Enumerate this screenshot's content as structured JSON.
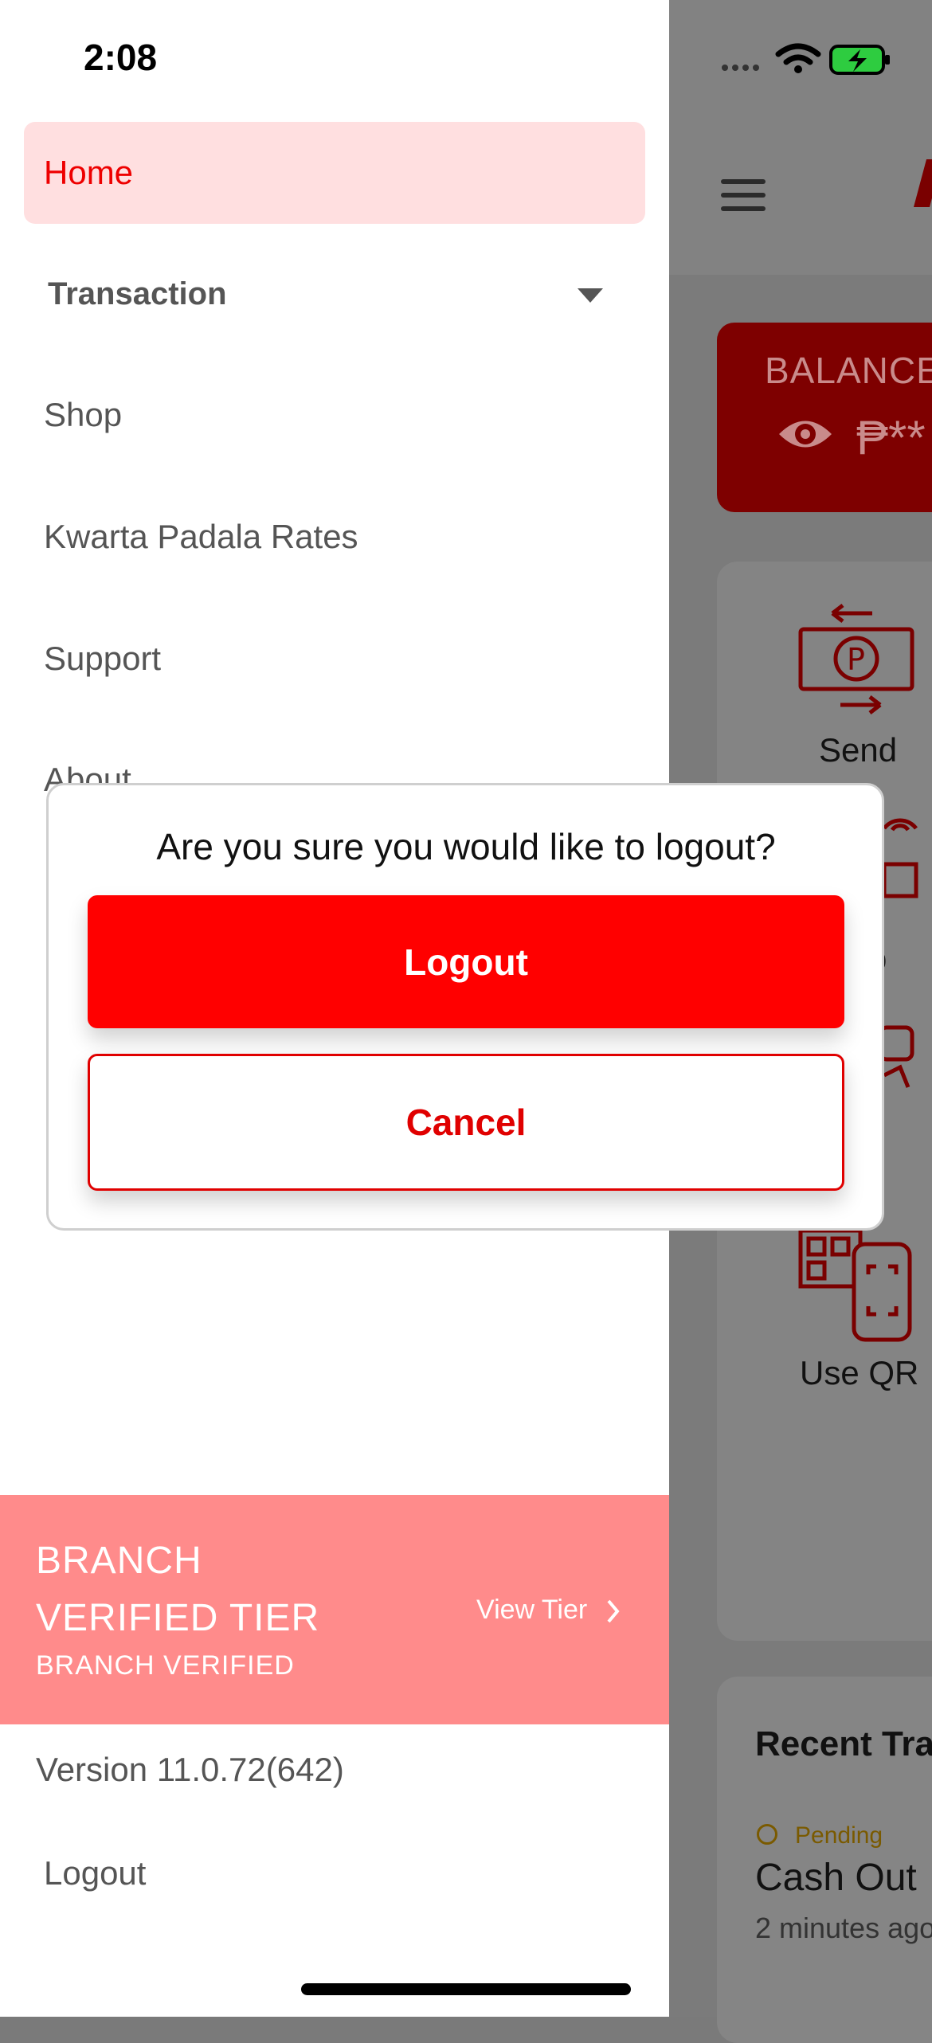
{
  "status_bar": {
    "time": "2:08"
  },
  "colors": {
    "accent": "#ff0000",
    "drawer_active_bg": "#ffdfe0",
    "tier_bg": "#ff8b8b"
  },
  "background": {
    "balance_label": "BALANCE",
    "balance_masked": "₱**",
    "services": [
      "Send",
      "p",
      "s",
      "Use QR"
    ],
    "recent_title": "Recent Tra",
    "recent_item": {
      "status": "Pending",
      "title": "Cash Out",
      "time": "2 minutes ago"
    }
  },
  "drawer": {
    "items": [
      {
        "label": "Home",
        "active": true
      },
      {
        "label": "Transaction"
      },
      {
        "label": "Shop"
      },
      {
        "label": "Kwarta Padala Rates"
      },
      {
        "label": "Support"
      },
      {
        "label": "About"
      }
    ],
    "tier": {
      "line1": "BRANCH",
      "line2": "VERIFIED TIER",
      "sub": "BRANCH VERIFIED",
      "view_tier": "View Tier"
    },
    "version": "Version 11.0.72(642)",
    "logout": "Logout"
  },
  "dialog": {
    "message": "Are you sure you would like to logout?",
    "confirm": "Logout",
    "cancel": "Cancel"
  }
}
